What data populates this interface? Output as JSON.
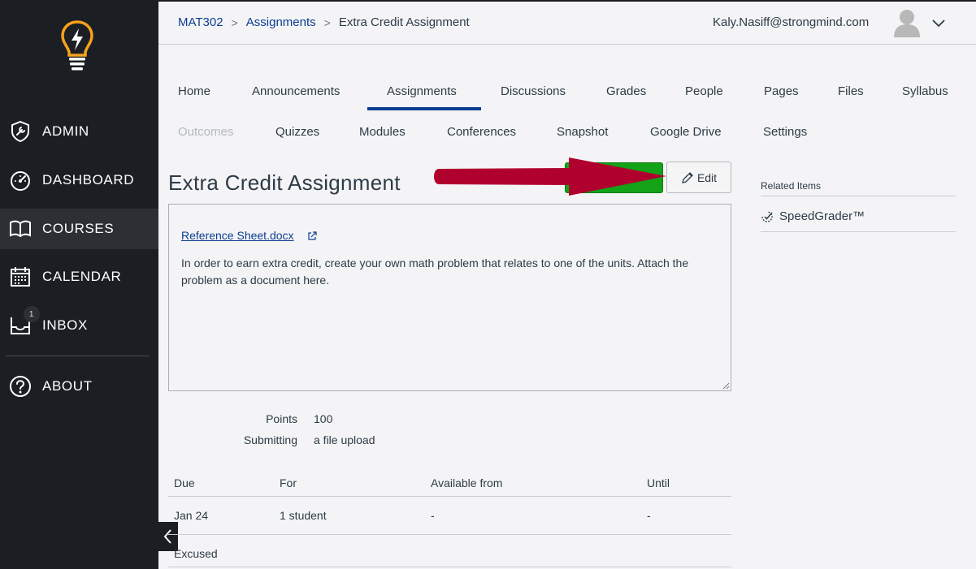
{
  "sidebar": {
    "items": [
      {
        "label": "ADMIN",
        "icon": "shield-wrench-icon"
      },
      {
        "label": "DASHBOARD",
        "icon": "speedometer-icon"
      },
      {
        "label": "COURSES",
        "icon": "book-icon"
      },
      {
        "label": "CALENDAR",
        "icon": "calendar-icon"
      },
      {
        "label": "INBOX",
        "icon": "inbox-icon",
        "badge": "1"
      },
      {
        "label": "ABOUT",
        "icon": "question-icon"
      }
    ],
    "active": "COURSES"
  },
  "breadcrumb": {
    "course": "MAT302",
    "section": "Assignments",
    "current": "Extra Credit Assignment"
  },
  "user": {
    "email": "Kaly.Nasiff@strongmind.com"
  },
  "tabs": {
    "row1": [
      "Home",
      "Announcements",
      "Assignments",
      "Discussions",
      "Grades",
      "People",
      "Pages",
      "Files",
      "Syllabus"
    ],
    "row2": [
      "Outcomes",
      "Quizzes",
      "Modules",
      "Conferences",
      "Snapshot",
      "Google Drive",
      "Settings"
    ],
    "active": "Assignments",
    "disabled": [
      "Outcomes"
    ]
  },
  "assignment": {
    "title": "Extra Credit Assignment",
    "edit_label": "Edit",
    "file_link": "Reference Sheet.docx",
    "description": "In order to earn extra credit, create your own math problem that relates to one of the units. Attach the problem as a document here.",
    "points_label": "Points",
    "points_value": "100",
    "submitting_label": "Submitting",
    "submitting_value": "a file upload"
  },
  "dates_table": {
    "headers": [
      "Due",
      "For",
      "Available from",
      "Until"
    ],
    "rows": [
      [
        "Jan 24",
        "1 student",
        "-",
        "-"
      ],
      [
        "Excused",
        "",
        "",
        ""
      ]
    ]
  },
  "related": {
    "title": "Related Items",
    "speedgrader": "SpeedGrader™"
  },
  "colors": {
    "sidebar_bg": "#1b1f23",
    "link": "#0c3d91",
    "logo_orange": "#f7a11b",
    "publish_green": "#13a218",
    "annotation_arrow": "#b0002e"
  }
}
